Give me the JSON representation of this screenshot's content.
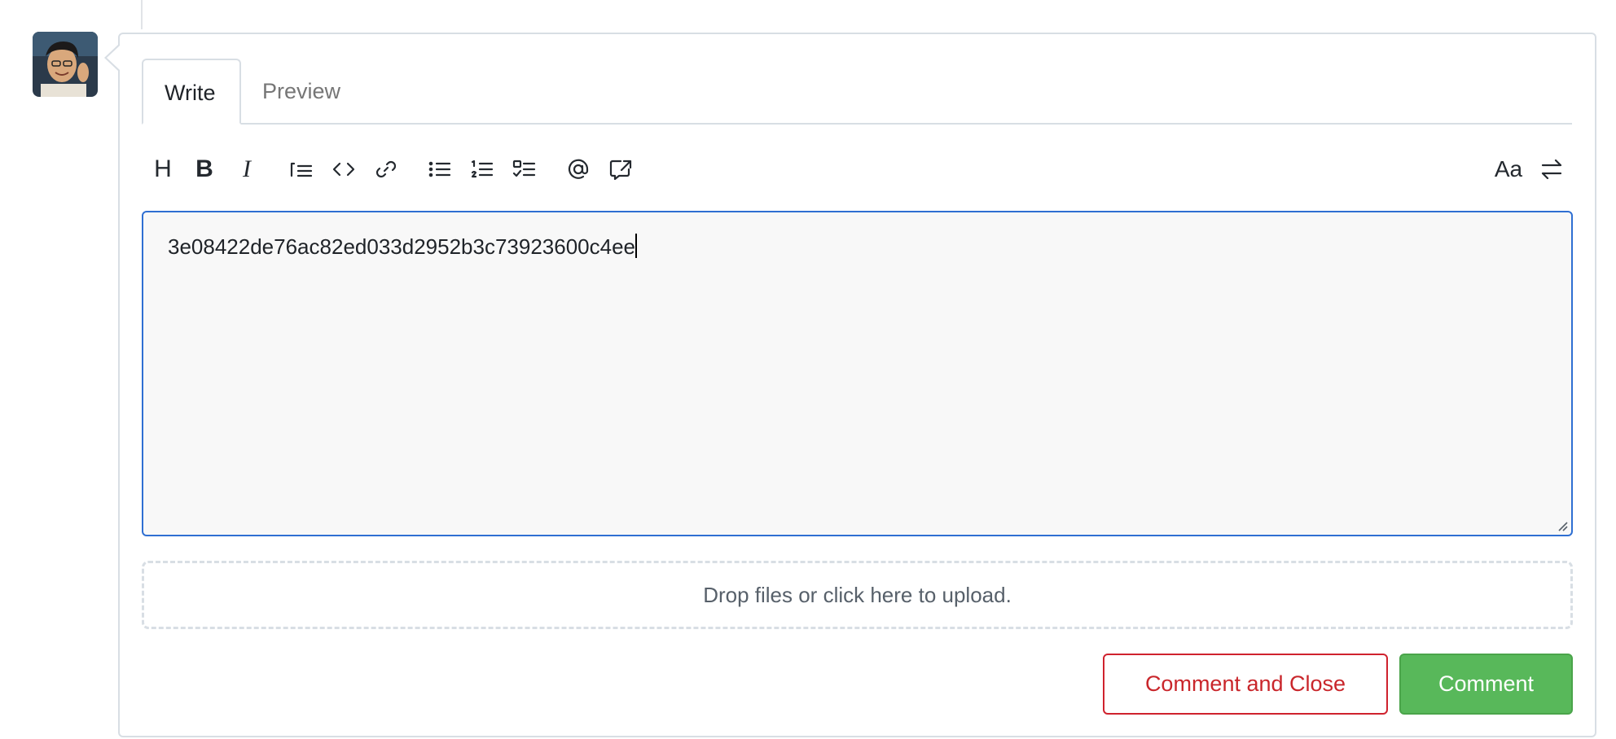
{
  "tabs": [
    {
      "label": "Write",
      "active": true
    },
    {
      "label": "Preview",
      "active": false
    }
  ],
  "toolbar": {
    "heading_label": "H",
    "bold_label": "B",
    "italic_label": "I",
    "text_size_label": "Aa",
    "icons": [
      "heading-icon",
      "bold-icon",
      "italic-icon",
      "quote-icon",
      "code-icon",
      "link-icon",
      "bulleted-list-icon",
      "numbered-list-icon",
      "task-list-icon",
      "mention-icon",
      "reference-icon",
      "text-size-icon",
      "switch-icon"
    ]
  },
  "editor": {
    "value": "3e08422de76ac82ed033d2952b3c73923600c4ee"
  },
  "dropzone": {
    "label": "Drop files or click here to upload."
  },
  "actions": {
    "comment_and_close_label": "Comment and Close",
    "comment_label": "Comment"
  },
  "colors": {
    "accent_blue": "#2f6fd2",
    "danger_red": "#c9262b",
    "success_green": "#58b85a"
  }
}
